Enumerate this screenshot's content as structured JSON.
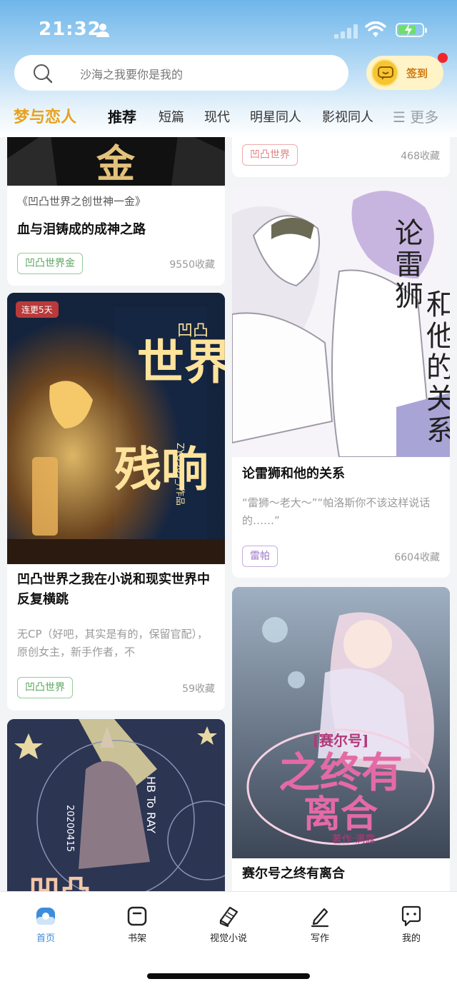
{
  "status_bar": {
    "time": "21:32"
  },
  "search": {
    "placeholder": "沙海之我要你是我的"
  },
  "checkin": {
    "label": "签到"
  },
  "tabs": {
    "brand": "梦与恋人",
    "items": [
      "推荐",
      "短篇",
      "现代",
      "明星同人",
      "影视同人"
    ],
    "more": "☰ 更多"
  },
  "cards": {
    "c1": {
      "cover_text": "金",
      "subtitle": "《凹凸世界之创世神一金》",
      "title": "血与泪铸成的成神之路",
      "tag": "凹凸世界金",
      "favorites": "9550收藏"
    },
    "c2": {
      "tag": "凹凸世界",
      "favorites": "468收藏"
    },
    "c3": {
      "cover_text": "论雷狮和他的关系",
      "title": "论雷狮和他的关系",
      "desc": "“雷狮～老大～”“帕洛斯你不该这样说话的……”",
      "tag": "雷帕",
      "favorites": "6604收藏"
    },
    "c4": {
      "badge": "连更5天",
      "cover_text_1": "世界",
      "cover_text_2": "残响",
      "cover_text_3": "凹凸",
      "cover_author": "ZYO309_/作品",
      "title": "凹凸世界之我在小说和现实世界中反复横跳",
      "desc": "无CP（好吧，其实是有的，保留官配），原创女主，新手作者，不",
      "tag": "凹凸世界",
      "favorites": "59收藏"
    },
    "c5": {
      "cover_text_1": "[赛尔号]",
      "cover_text_2": "之终有",
      "cover_text_3": "离合",
      "cover_text_4": "著作:满露",
      "title": "赛尔号之终有离合"
    },
    "c6": {
      "cover_text_1": "HB To RAY",
      "cover_text_2": "20200415",
      "cover_text_3": "凹凸"
    }
  },
  "bottom_nav": [
    {
      "label": "首页"
    },
    {
      "label": "书架"
    },
    {
      "label": "视觉小说"
    },
    {
      "label": "写作"
    },
    {
      "label": "我的"
    }
  ],
  "colors": {
    "accent": "#3c8ddb",
    "brand": "#e8a21a",
    "badge": "#b83a3a"
  }
}
